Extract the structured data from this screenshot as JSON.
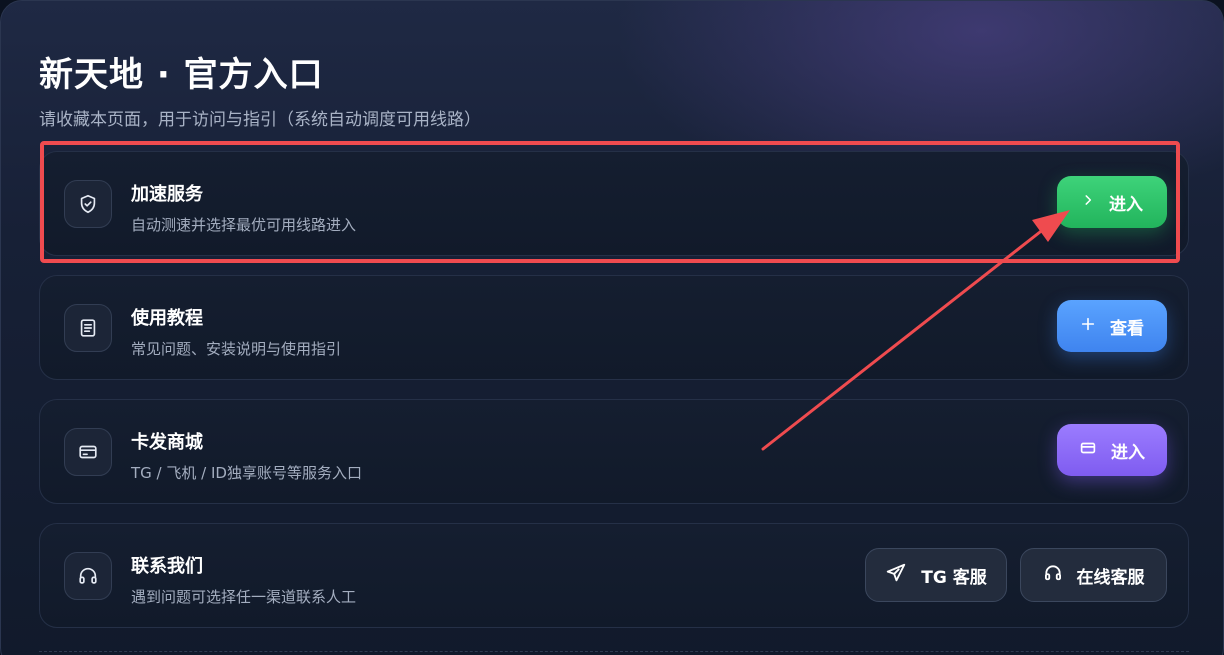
{
  "header": {
    "title": "新天地 · 官方入口",
    "subtitle": "请收藏本页面，用于访问与指引（系统自动调度可用线路）"
  },
  "cards": [
    {
      "name": "加速服务",
      "desc": "自动测速并选择最优可用线路进入",
      "icon": "shield-check-icon",
      "button": {
        "label": "进入",
        "icon": "chevron-right-icon",
        "color": "#2ec26a"
      }
    },
    {
      "name": "使用教程",
      "desc": "常见问题、安装说明与使用指引",
      "icon": "document-icon",
      "button": {
        "label": "查看",
        "icon": "plus-icon",
        "color": "#4a92f6"
      }
    },
    {
      "name": "卡发商城",
      "desc": "TG / 飞机 / ID独享账号等服务入口",
      "icon": "card-icon",
      "button": {
        "label": "进入",
        "icon": "card-icon",
        "color": "#8a6af6"
      }
    },
    {
      "name": "联系我们",
      "desc": "遇到问题可选择任一渠道联系人工",
      "icon": "headset-icon",
      "buttons": [
        {
          "label": "TG 客服",
          "icon": "send-icon"
        },
        {
          "label": "在线客服",
          "icon": "headset-icon"
        }
      ]
    }
  ],
  "annotation": {
    "highlight_color": "#ef4b4f"
  }
}
